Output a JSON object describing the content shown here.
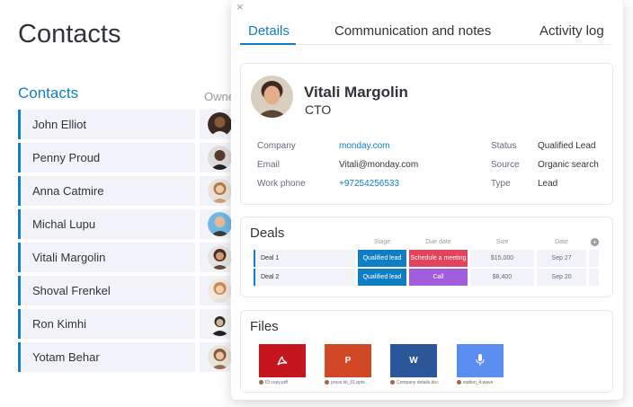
{
  "board": {
    "title": "Contacts",
    "group_title": "Contacts",
    "owner_column": "Owner",
    "rows": [
      {
        "name": "John Elliot"
      },
      {
        "name": "Penny Proud"
      },
      {
        "name": "Anna Catmire"
      },
      {
        "name": "Michal Lupu"
      },
      {
        "name": "Vitali Margolin"
      },
      {
        "name": "Shoval Frenkel"
      },
      {
        "name": "Ron Kimhi"
      },
      {
        "name": "Yotam Behar"
      }
    ]
  },
  "panel": {
    "close_icon": "×",
    "tabs": [
      {
        "label": "Details",
        "active": true
      },
      {
        "label": "Communication and notes",
        "active": false
      },
      {
        "label": "Activity log",
        "active": false
      }
    ],
    "contact": {
      "name": "Vitali Margolin",
      "title": "CTO",
      "company_label": "Company",
      "company": "monday.com",
      "email_label": "Email",
      "email": "Vitali@monday.com",
      "phone_label": "Work phone",
      "phone": "+97254256533",
      "status_label": "Status",
      "status": "Qualified Lead",
      "source_label": "Source",
      "source": "Organic search",
      "type_label": "Type",
      "type": "Lead"
    },
    "deals": {
      "title": "Deals",
      "columns": {
        "stage": "Stage",
        "due": "Due date",
        "size": "Size",
        "date": "Date"
      },
      "add_icon": "+",
      "rows": [
        {
          "name": "Deal 1",
          "stage": "Qualified lead",
          "due": "Schedule a meeting",
          "due_color": "#e2445c",
          "size": "$15,000",
          "date": "Sep 27"
        },
        {
          "name": "Deal 2",
          "stage": "Qualified lead",
          "due": "Call",
          "due_color": "#a25ddc",
          "size": "$8,400",
          "date": "Sep 20"
        }
      ]
    },
    "files": {
      "title": "Files",
      "items": [
        {
          "icon": "pdf-icon",
          "glyph": "",
          "color": "#c4161c",
          "caption": "ID copy.pdf"
        },
        {
          "icon": "powerpoint-icon",
          "glyph": "P",
          "color": "#d24726",
          "caption": "press kit_01.pptx"
        },
        {
          "icon": "word-icon",
          "glyph": "W",
          "color": "#2b579a",
          "caption": "Company details.doc"
        },
        {
          "icon": "audio-icon",
          "glyph": "",
          "color": "#5b8def",
          "caption": "station_4.wave"
        }
      ]
    }
  },
  "colors": {
    "accent": "#0f7ec4",
    "pink": "#e2445c",
    "purple": "#a25ddc"
  }
}
